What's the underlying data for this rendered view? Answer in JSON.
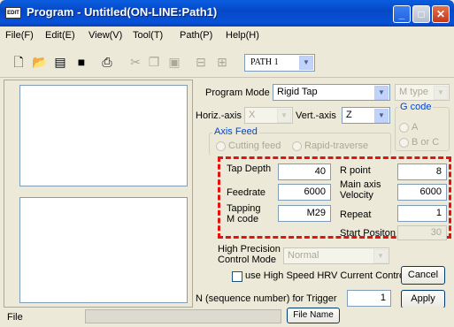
{
  "window": {
    "title": "Program - Untitled(ON-LINE:Path1)",
    "icon_text": "EDIT"
  },
  "menu": [
    "File(F)",
    "Edit(E)",
    "View(V)",
    "Tool(T)",
    "Path(P)",
    "Help(H)"
  ],
  "toolbar": {
    "icons": [
      "new-file-icon",
      "open-folder-icon",
      "open-program-icon",
      "save-icon",
      "print-icon",
      "cut-icon",
      "copy-icon",
      "paste-icon",
      "read-from-cnc-icon",
      "write-to-cnc-icon"
    ],
    "path_select": "PATH 1"
  },
  "form": {
    "program_mode_label": "Program Mode",
    "program_mode_value": "Rigid Tap",
    "m_type_value": "M type",
    "horiz_axis_label": "Horiz.-axis",
    "horiz_axis_value": "X",
    "vert_axis_label": "Vert.-axis",
    "vert_axis_value": "Z",
    "g_code_group": "G code",
    "g_code_a": "A",
    "g_code_b_or_c": "B or C",
    "axis_feed_group": "Axis Feed",
    "cutting_feed": "Cutting feed",
    "rapid_traverse": "Rapid-traverse",
    "tap_depth_label": "Tap Depth",
    "tap_depth_value": "40",
    "r_point_label": "R point",
    "r_point_value": "8",
    "feedrate_label": "Feedrate",
    "feedrate_value": "6000",
    "main_axis_velocity_label_1": "Main axis",
    "main_axis_velocity_label_2": "Velocity",
    "main_axis_velocity_value": "6000",
    "tapping_m_code_label_1": "Tapping",
    "tapping_m_code_label_2": "M code",
    "tapping_m_code_value": "M29",
    "repeat_label": "Repeat",
    "repeat_value": "1",
    "start_position_label": "Start Positon",
    "start_position_value": "30",
    "hp_control_label_1": "High Precision",
    "hp_control_label_2": "Control Mode",
    "hp_control_value": "Normal",
    "hrv_checkbox_label": "use High Speed HRV Current Control",
    "cancel_label": "Cancel",
    "n_trigger_label": "N (sequence number) for Trigger",
    "n_trigger_value": "1",
    "apply_label": "Apply"
  },
  "status": {
    "file_label": "File",
    "file_name_button": "File Name"
  },
  "colors": {
    "titlebar": "#0548c6",
    "highlight_box": "#e3140f",
    "group_title": "#0046d5"
  }
}
